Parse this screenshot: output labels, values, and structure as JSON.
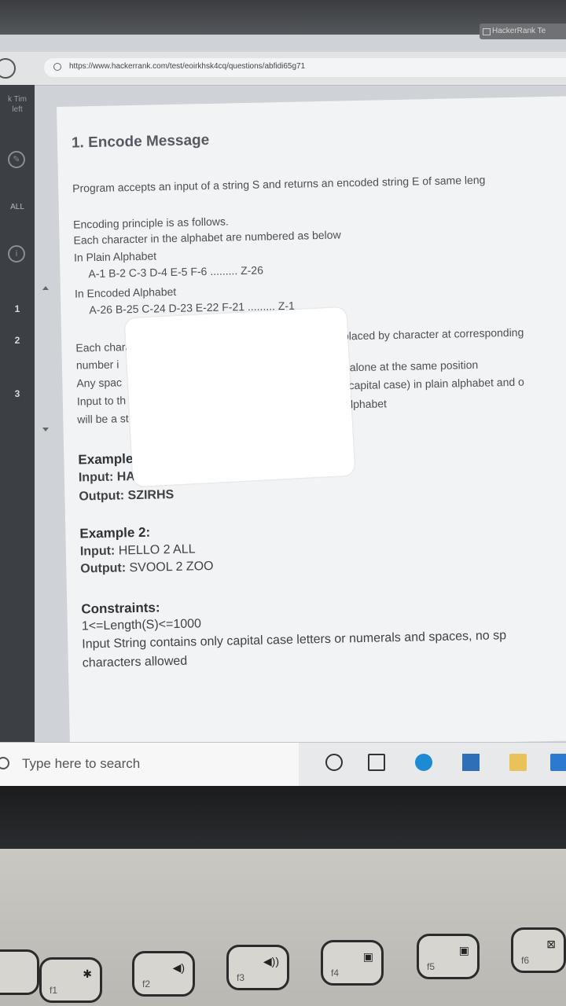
{
  "browser": {
    "url": "https://www.hackerrank.com/test/eoirkhsk4cq/questions/abfidi65g71",
    "tab_label": "HackerRank Te"
  },
  "left_rail": {
    "top_text": "k Tim\nleft",
    "all_label": "ALL",
    "question_numbers": [
      "1",
      "2",
      "3"
    ]
  },
  "question": {
    "title": "1. Encode Message",
    "intro": "Program accepts an input of a string S and returns an encoded string E of same leng",
    "principle_heading": "Encoding principle is as follows.",
    "numbering_intro": "Each character in the alphabet are numbered as below",
    "plain_heading": "In Plain Alphabet",
    "plain_values": "A-1 B-2 C-3 D-4  E-5 F-6 ......... Z-26",
    "encoded_heading": "In Encoded Alphabet",
    "encoded_values": "A-26 B-25 C-24 D-23 E-22 F-21 ......... Z-1",
    "rule_line1_left": "Each charact",
    "rule_line1_right": "eplaced by character at corresponding",
    "rule_line2_left": "number i",
    "rule_line2_right": "t alone at the same position",
    "rule_line3_left": "Any spac",
    "rule_line3_right": "capital case) in plain alphabet and o",
    "rule_line4_left": "Input to th",
    "rule_line4_right": "lphabet",
    "rule_line5_left": "will be a st",
    "example1_title": "Example 1",
    "example1_input": "Input:  HAR",
    "example1_output": "Output:  SZIRHS",
    "example2_title": "Example 2:",
    "example2_input_label": "Input:",
    "example2_input_value": "HELLO 2 ALL",
    "example2_output_label": "Output:",
    "example2_output_value": "SVOOL 2 ZOO",
    "constraints_title": "Constraints:",
    "constraint1": "1<=Length(S)<=1000",
    "constraint2": "Input String contains only capital case letters or numerals and spaces, no sp",
    "constraint3": "characters allowed"
  },
  "taskbar": {
    "search_placeholder": "Type here to search",
    "apps": [
      "cortana-icon",
      "task-view-icon",
      "edge-icon",
      "store-icon",
      "file-explorer-icon",
      "mail-icon"
    ]
  },
  "keyboard": {
    "keys": [
      {
        "fn": "f1",
        "glyph": "✱"
      },
      {
        "fn": "f2",
        "glyph": "◀)"
      },
      {
        "fn": "f3",
        "glyph": "◀))"
      },
      {
        "fn": "f4",
        "glyph": "▣"
      },
      {
        "fn": "f5",
        "glyph": "▣"
      },
      {
        "fn": "f6",
        "glyph": "⊠"
      }
    ]
  },
  "colors": {
    "rail_bg": "#3c3f44",
    "content_bg": "#f2f3f4",
    "redaction": "#ffffff"
  }
}
